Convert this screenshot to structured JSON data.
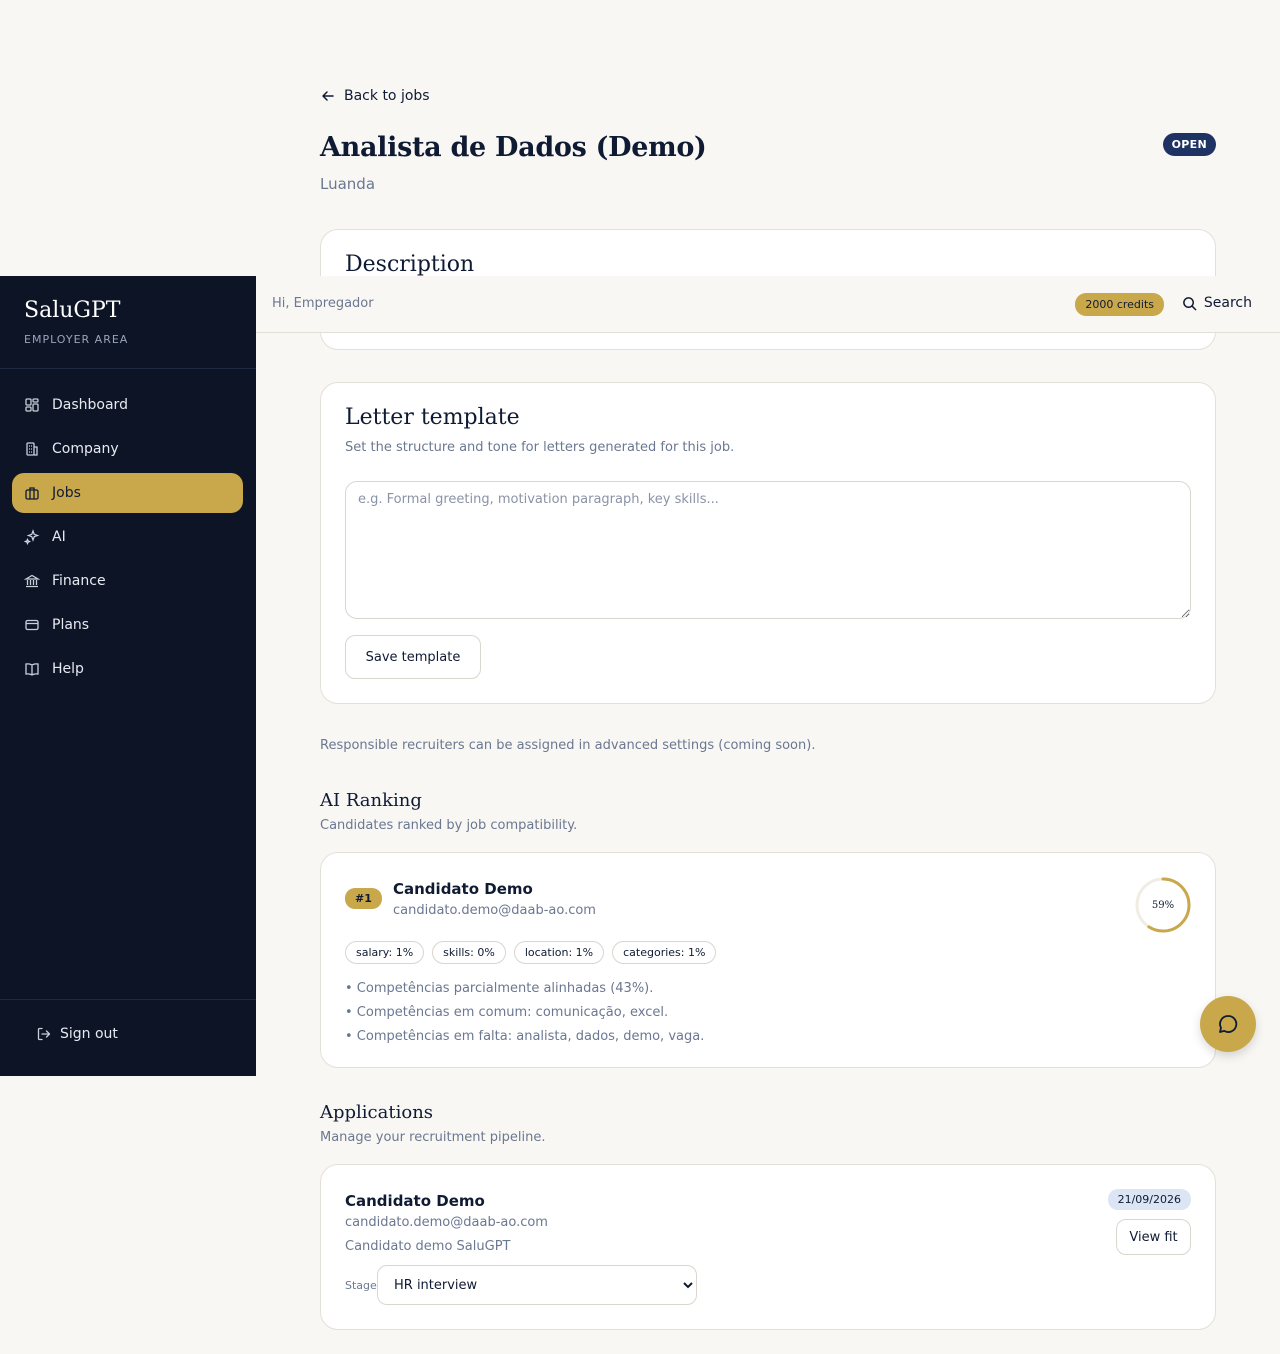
{
  "job": {
    "back_label": "Back to jobs",
    "title": "Analista de Dados (Demo)",
    "location": "Luanda",
    "status": "OPEN"
  },
  "description": {
    "title": "Description",
    "text": ""
  },
  "letter_template": {
    "title": "Letter template",
    "subtitle": "Set the structure and tone for letters generated for this job.",
    "placeholder": "e.g. Formal greeting, motivation paragraph, key skills...",
    "value": "",
    "save_label": "Save template"
  },
  "recruiters_note": "Responsible recruiters can be assigned in advanced settings (coming soon).",
  "ai_ranking": {
    "title": "AI Ranking",
    "subtitle": "Candidates ranked by job compatibility.",
    "candidates": [
      {
        "rank": "#1",
        "name": "Candidato Demo",
        "email": "candidato.demo@daab-ao.com",
        "score_label": "59%",
        "score_value": 0.59,
        "chips": [
          "salary: 1%",
          "skills: 0%",
          "location: 1%",
          "categories: 1%"
        ],
        "bullets": [
          "• Competências parcialmente alinhadas (43%).",
          "• Competências em comum: comunicação, excel.",
          "• Competências em falta: analista, dados, demo, vaga."
        ]
      }
    ]
  },
  "applications": {
    "title": "Applications",
    "subtitle": "Manage your recruitment pipeline.",
    "items": [
      {
        "name": "Candidato Demo",
        "email": "candidato.demo@daab-ao.com",
        "note": "Candidato demo SaluGPT",
        "date": "21/09/2026",
        "view_fit_label": "View fit",
        "stage_label": "Stage",
        "stage_value": "HR interview"
      }
    ]
  },
  "topbar": {
    "greeting": "Hi, Empregador",
    "credits": "2000 credits",
    "search_label": "Search"
  },
  "sidebar": {
    "brand": "SaluGPT",
    "area": "EMPLOYER AREA",
    "items": [
      {
        "label": "Dashboard",
        "icon": "dashboard-icon"
      },
      {
        "label": "Company",
        "icon": "building-icon"
      },
      {
        "label": "Jobs",
        "icon": "briefcase-icon",
        "active": true
      },
      {
        "label": "AI",
        "icon": "sparkles-icon"
      },
      {
        "label": "Finance",
        "icon": "bank-icon"
      },
      {
        "label": "Plans",
        "icon": "credit-card-icon"
      },
      {
        "label": "Help",
        "icon": "book-icon"
      }
    ],
    "signout_label": "Sign out"
  },
  "colors": {
    "navy": "#0c1426",
    "gold": "#c9a84c",
    "status_badge": "#1e3264",
    "date_badge": "#dbe5f3"
  }
}
